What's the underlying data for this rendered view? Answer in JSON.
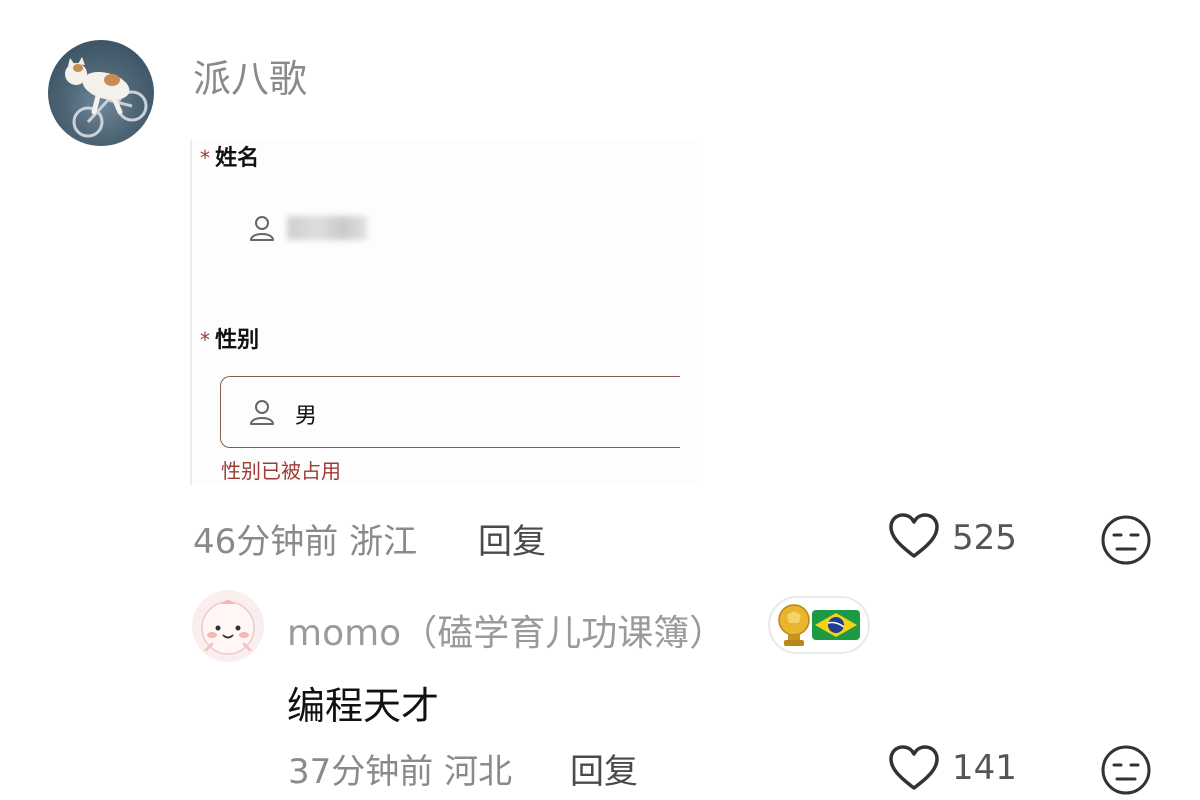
{
  "comment": {
    "username": "派八歌",
    "form": {
      "name_label": "姓名",
      "required_mark": "*",
      "gender_label": "性别",
      "gender_value": "男",
      "error": "性别已被占用"
    },
    "time": "46分钟前",
    "location": "浙江",
    "reply_label": "回复",
    "likes": "525"
  },
  "reply": {
    "username": "momo（磕学育儿功课簿）",
    "text": "编程天才",
    "time": "37分钟前",
    "location": "河北",
    "reply_label": "回复",
    "likes": "141"
  },
  "icons": {
    "like": "heart-outline-icon",
    "dislike": "neutral-face-icon",
    "person": "person-icon",
    "badge": "golden-ball-trophy-icon",
    "flag": "brazil-flag-icon"
  },
  "colors": {
    "error": "#9e3b33",
    "muted": "#8a8a8a"
  }
}
